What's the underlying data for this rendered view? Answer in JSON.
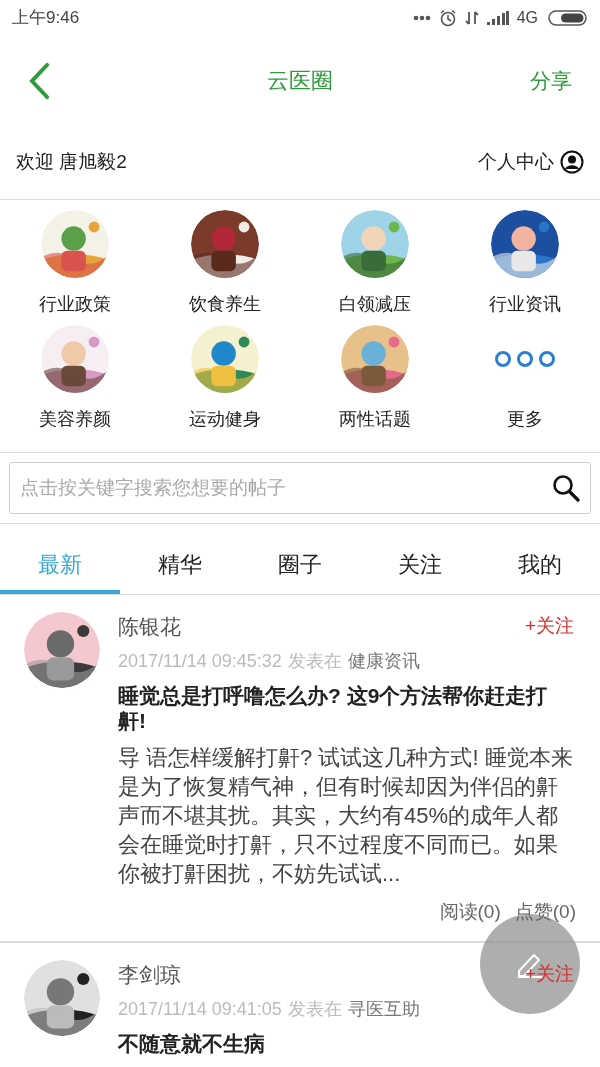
{
  "status_bar": {
    "time": "上午9:46",
    "network": "4G"
  },
  "header": {
    "title": "云医圈",
    "action": "分享"
  },
  "welcome": {
    "greeting": "欢迎 唐旭毅2",
    "profile_link": "个人中心"
  },
  "categories": [
    {
      "label": "行业政策",
      "kind": "picture"
    },
    {
      "label": "饮食养生",
      "kind": "picture"
    },
    {
      "label": "白领减压",
      "kind": "picture"
    },
    {
      "label": "行业资讯",
      "kind": "picture"
    },
    {
      "label": "美容养颜",
      "kind": "picture"
    },
    {
      "label": "运动健身",
      "kind": "picture"
    },
    {
      "label": "两性话题",
      "kind": "picture"
    },
    {
      "label": "更多",
      "kind": "more"
    }
  ],
  "search": {
    "placeholder": "点击按关键字搜索您想要的帖子"
  },
  "tabs": [
    {
      "label": "最新",
      "selected": true
    },
    {
      "label": "精华",
      "selected": false
    },
    {
      "label": "圈子",
      "selected": false
    },
    {
      "label": "关注",
      "selected": false
    },
    {
      "label": "我的",
      "selected": false
    }
  ],
  "posts": [
    {
      "author": "陈银花",
      "follow": "+关注",
      "time": "2017/11/14 09:45:32",
      "posted_in": "发表在",
      "board": "健康资讯",
      "title": "睡觉总是打呼噜怎么办? 这9个方法帮你赶走打鼾!",
      "excerpt": "导 语怎样缓解打鼾? 试试这几种方式! 睡觉本来是为了恢复精气神，但有时候却因为伴侣的鼾声而不堪其扰。其实，大约有45%的成年人都会在睡觉时打鼾，只不过程度不同而已。如果你被打鼾困扰，不妨先试试...",
      "reads": "阅读(0)",
      "likes": "点赞(0)"
    },
    {
      "author": "李剑琼",
      "follow": "+关注",
      "time": "2017/11/14 09:41:05",
      "posted_in": "发表在",
      "board": "寻医互助",
      "title": "不随意就不生病"
    }
  ]
}
